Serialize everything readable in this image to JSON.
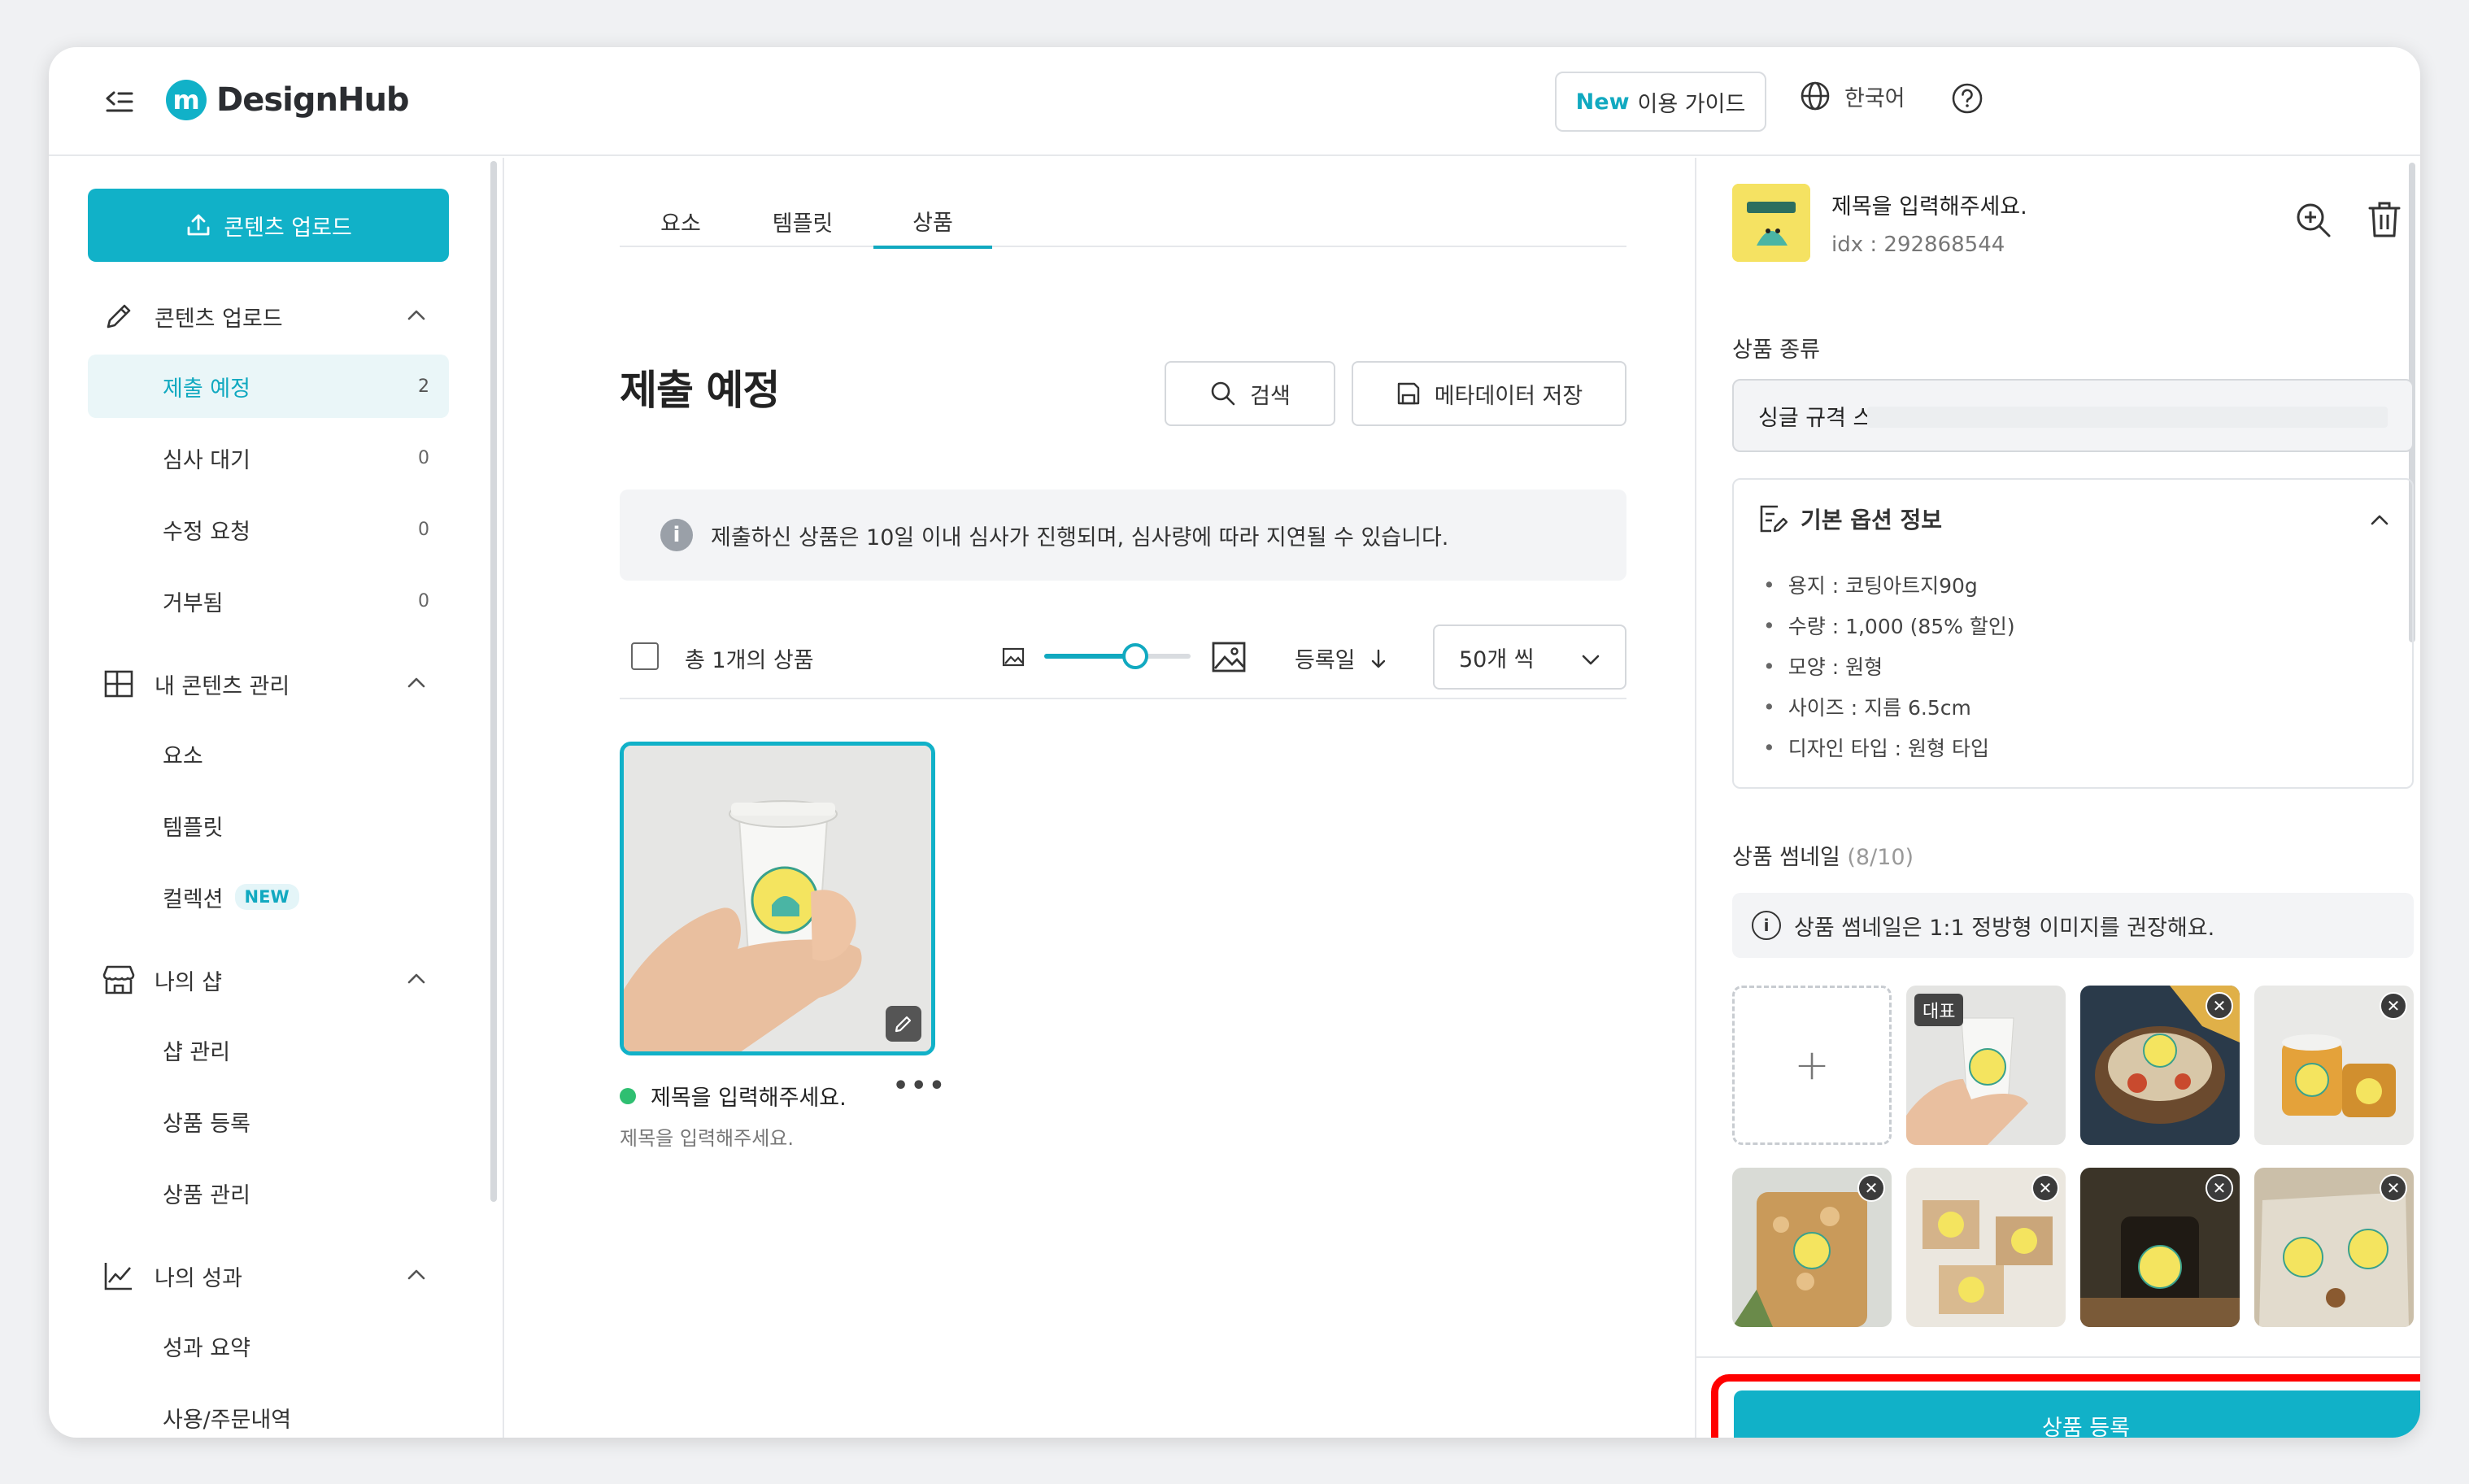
{
  "app": {
    "name": "DesignHub",
    "logo_letter": "m"
  },
  "header": {
    "guide_new": "New",
    "guide_label": "이용 가이드",
    "language": "한국어",
    "icons": [
      "menu-collapse-icon",
      "globe-icon",
      "help-icon"
    ]
  },
  "sidebar": {
    "upload_button": "콘텐츠 업로드",
    "sections": [
      {
        "label": "콘텐츠 업로드",
        "icon": "pencil-icon",
        "items": [
          {
            "label": "제출 예정",
            "count": "2",
            "active": true
          },
          {
            "label": "심사 대기",
            "count": "0"
          },
          {
            "label": "수정 요청",
            "count": "0"
          },
          {
            "label": "거부됨",
            "count": "0"
          }
        ]
      },
      {
        "label": "내 콘텐츠 관리",
        "icon": "layout-icon",
        "items": [
          {
            "label": "요소"
          },
          {
            "label": "템플릿"
          },
          {
            "label": "컬렉션",
            "badge": "NEW"
          }
        ]
      },
      {
        "label": "나의 샵",
        "icon": "store-icon",
        "items": [
          {
            "label": "샵 관리"
          },
          {
            "label": "상품 등록"
          },
          {
            "label": "상품 관리"
          }
        ]
      },
      {
        "label": "나의 성과",
        "icon": "chart-line-icon",
        "items": [
          {
            "label": "성과 요약"
          },
          {
            "label": "사용/주문내역"
          }
        ]
      }
    ]
  },
  "main": {
    "tabs": [
      "요소",
      "템플릿",
      "상품"
    ],
    "active_tab": "상품",
    "title": "제출 예정",
    "search_button": "검색",
    "save_meta_button": "메타데이터 저장",
    "notice": "제출하신 상품은 10일 이내 심사가 진행되며, 심사량에 따라 지연될 수 있습니다.",
    "total": "총 1개의 상품",
    "thumb_size_level": 0.62,
    "sort_label": "등록일",
    "page_size": "50개 씩",
    "card": {
      "title": "제목을 입력해주세요.",
      "subtitle": "제목을 입력해주세요.",
      "status_color": "#2fbf71"
    }
  },
  "panel": {
    "title": "제목을 입력해주세요.",
    "idx": "idx : 292868544",
    "product_type_label": "상품 종류",
    "product_type_value": "싱글 규격 스티커",
    "options_title": "기본 옵션 정보",
    "options": [
      "용지 : 코팅아트지90g",
      "수량 : 1,000 (85% 할인)",
      "모양 : 원형",
      "사이즈 : 지름 6.5cm",
      "디자인 타입 : 원형 타입"
    ],
    "thumb_label": "상품 썸네일",
    "thumb_count": "(8/10)",
    "thumb_tip": "상품 썸네일은 1:1 정방형 이미지를 권장해요.",
    "add_symbol": "+",
    "rep_label": "대표",
    "remove_symbol": "✕",
    "register_button": "상품 등록"
  },
  "colors": {
    "accent": "#11b1c8",
    "highlight": "#ff0000",
    "status_green": "#2fbf71"
  }
}
